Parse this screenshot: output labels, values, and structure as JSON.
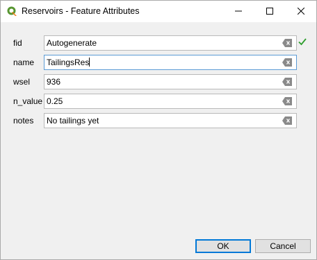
{
  "window": {
    "title": "Reservoirs - Feature Attributes",
    "app_icon": "qgis-icon"
  },
  "titlebar_buttons": {
    "minimize_icon": "minimize-icon",
    "maximize_icon": "maximize-icon",
    "close_icon": "close-icon"
  },
  "fields": [
    {
      "label": "fid",
      "value": "Autogenerate",
      "valid": true
    },
    {
      "label": "name",
      "value": "TailingsRes",
      "focused": true
    },
    {
      "label": "wsel",
      "value": "936"
    },
    {
      "label": "n_value",
      "value": "0.25"
    },
    {
      "label": "notes",
      "value": "No tailings yet"
    }
  ],
  "buttons": {
    "ok": "OK",
    "cancel": "Cancel"
  },
  "colors": {
    "focus_border": "#5b9bd5",
    "check_green": "#2e9e2e",
    "ok_border": "#0078d7"
  }
}
